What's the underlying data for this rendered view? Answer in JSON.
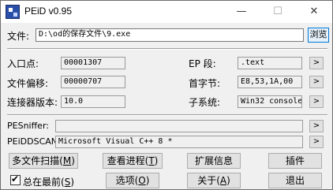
{
  "window": {
    "title": "PEiD v0.95"
  },
  "controls": {
    "minimize": "—",
    "maximize": "☐",
    "close": "✕"
  },
  "file": {
    "label": "文件:",
    "path": "D:\\od的保存文件\\9.exe",
    "browse": "浏览"
  },
  "info": {
    "entry_point": {
      "label": "入口点:",
      "value": "00001307"
    },
    "file_offset": {
      "label": "文件偏移:",
      "value": "00000707"
    },
    "linker": {
      "label": "连接器版本:",
      "value": "10.0"
    },
    "ep_section": {
      "label": "EP 段:",
      "value": ".text"
    },
    "first_bytes": {
      "label": "首字节:",
      "value": "E8,53,1A,00"
    },
    "subsystem": {
      "label": "子系统:",
      "value": "Win32 console"
    }
  },
  "arrow": ">",
  "pesniffer": {
    "label": "PESniffer:",
    "value": ""
  },
  "peiddscan": {
    "label": "PEiDDSCAN:",
    "value": "Microsoft Visual C++ 8 *"
  },
  "buttons": {
    "multi_scan": "多文件扫描",
    "multi_scan_key": "M",
    "view_process": "查看进程",
    "view_process_key": "T",
    "ext_info": "扩展信息",
    "plugins": "插件",
    "options": "选项",
    "options_key": "O",
    "about": "关于",
    "about_key": "A",
    "exit": "退出"
  },
  "always_on_top": {
    "label": "总在最前",
    "key": "S",
    "checked": true,
    "tick": "✔"
  }
}
